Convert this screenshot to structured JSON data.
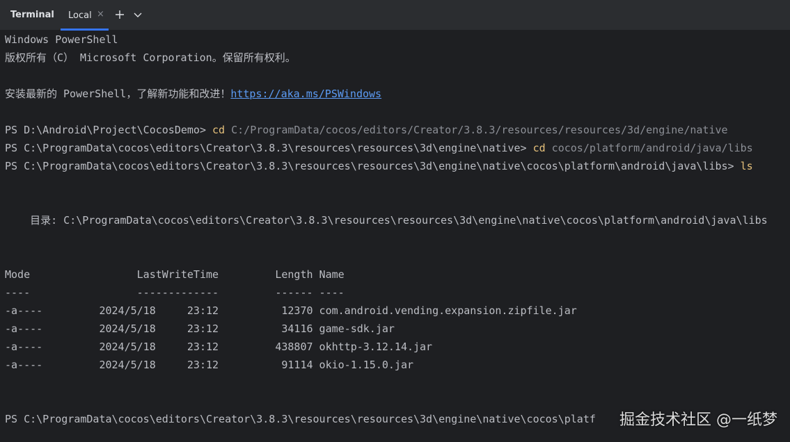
{
  "panel": {
    "title": "Terminal",
    "tab_label": "Local",
    "tab_close": "×"
  },
  "console": {
    "header_1": "Windows PowerShell",
    "header_2": "版权所有（C） Microsoft Corporation。保留所有权利。",
    "install_text": "安装最新的 PowerShell，了解新功能和改进！",
    "install_link": "https://aka.ms/PSWindows",
    "cmd1_prompt": "PS D:\\Android\\Project\\CocosDemo> ",
    "cmd1_command": "cd",
    "cmd1_arg": " C:/ProgramData/cocos/editors/Creator/3.8.3/resources/resources/3d/engine/native",
    "cmd2_prompt": "PS C:\\ProgramData\\cocos\\editors\\Creator\\3.8.3\\resources\\resources\\3d\\engine\\native> ",
    "cmd2_command": "cd",
    "cmd2_arg": " cocos/platform/android/java/libs",
    "cmd3_prompt": "PS C:\\ProgramData\\cocos\\editors\\Creator\\3.8.3\\resources\\resources\\3d\\engine\\native\\cocos\\platform\\android\\java\\libs> ",
    "cmd3_command": "ls",
    "directory_line": "    目录: C:\\ProgramData\\cocos\\editors\\Creator\\3.8.3\\resources\\resources\\3d\\engine\\native\\cocos\\platform\\android\\java\\libs",
    "table_header": "Mode                 LastWriteTime         Length Name",
    "table_rule": "----                 -------------         ------ ----",
    "rows": [
      "-a----         2024/5/18     23:12          12370 com.android.vending.expansion.zipfile.jar",
      "-a----         2024/5/18     23:12          34116 game-sdk.jar",
      "-a----         2024/5/18     23:12         438807 okhttp-3.12.14.jar",
      "-a----         2024/5/18     23:12          91114 okio-1.15.0.jar"
    ],
    "final_prompt": "PS C:\\ProgramData\\cocos\\editors\\Creator\\3.8.3\\resources\\resources\\3d\\engine\\native\\cocos\\platf"
  },
  "watermark": "掘金技术社区 @一纸梦",
  "icons": {
    "new_tab": "plus-icon",
    "tab_menu": "chevron-down-icon"
  },
  "colors": {
    "tab_accent": "#3574f0",
    "command": "#e5c07b",
    "argument": "#8c8f96",
    "link": "#5c9cf5",
    "text": "#bcbec4",
    "console_bg": "#1e1f22",
    "panel_bg": "#2b2d30"
  }
}
